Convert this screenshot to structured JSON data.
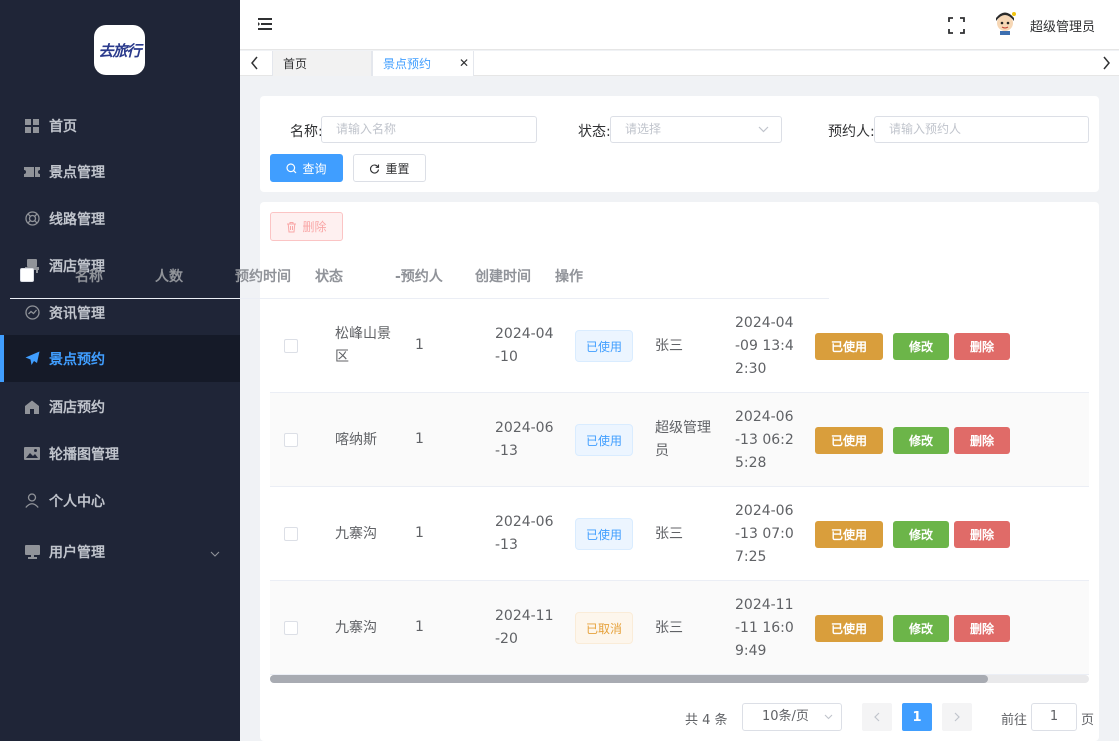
{
  "app": {
    "logo_text": "去旅行"
  },
  "sidebar": {
    "items": [
      {
        "label": "首页",
        "icon": "grid-icon"
      },
      {
        "label": "景点管理",
        "icon": "ticket-icon"
      },
      {
        "label": "线路管理",
        "icon": "lifebuoy-icon"
      },
      {
        "label": "酒店管理",
        "icon": "chair-icon"
      },
      {
        "label": "资讯管理",
        "icon": "chart-circle-icon"
      },
      {
        "label": "景点预约",
        "icon": "paper-plane-icon",
        "active": true
      },
      {
        "label": "酒店预约",
        "icon": "home-icon"
      },
      {
        "label": "轮播图管理",
        "icon": "image-icon"
      },
      {
        "label": "个人中心",
        "icon": "user-icon"
      },
      {
        "label": "用户管理",
        "icon": "monitor-icon",
        "expandable": true
      }
    ]
  },
  "header": {
    "username": "超级管理员"
  },
  "tags": {
    "home": "首页",
    "current": "景点预约"
  },
  "search": {
    "name_label": "名称:",
    "name_placeholder": "请输入名称",
    "status_label": "状态:",
    "status_placeholder": "请选择",
    "booker_label": "预约人:",
    "booker_placeholder": "请输入预约人",
    "query_label": "查询",
    "reset_label": "重置"
  },
  "toolbar": {
    "delete_label": "删除"
  },
  "table": {
    "headers": [
      "名称",
      "人数",
      "预约时间",
      "状态",
      "-预约人",
      "创建时间",
      "操作"
    ],
    "rows": [
      {
        "name": [
          "松峰山景",
          "区"
        ],
        "count": "1",
        "date": [
          "2024-04",
          "-10"
        ],
        "status": "已使用",
        "status_type": "used",
        "booker": [
          "张三"
        ],
        "created": [
          "2024-04",
          "-09 13:4",
          "2:30"
        ]
      },
      {
        "name": [
          "喀纳斯"
        ],
        "count": "1",
        "date": [
          "2024-06",
          "-13"
        ],
        "status": "已使用",
        "status_type": "used",
        "booker": [
          "超级管理",
          "员"
        ],
        "created": [
          "2024-06",
          "-13 06:2",
          "5:28"
        ]
      },
      {
        "name": [
          "九寨沟"
        ],
        "count": "1",
        "date": [
          "2024-06",
          "-13"
        ],
        "status": "已使用",
        "status_type": "used",
        "booker": [
          "张三"
        ],
        "created": [
          "2024-06",
          "-13 07:0",
          "7:25"
        ]
      },
      {
        "name": [
          "九寨沟"
        ],
        "count": "1",
        "date": [
          "2024-11",
          "-20"
        ],
        "status": "已取消",
        "status_type": "cancel",
        "booker": [
          "张三"
        ],
        "created": [
          "2024-11",
          "-11 16:0",
          "9:49"
        ]
      }
    ],
    "actions": {
      "used": "已使用",
      "edit": "修改",
      "delete": "删除"
    }
  },
  "pagination": {
    "total_text": "共 4 条",
    "page_size": "10条/页",
    "current_page": "1",
    "goto_label": "前往",
    "goto_value": "1",
    "page_suffix": "页"
  },
  "colors": {
    "primary": "#409eff",
    "sidebar_bg": "#1f2537",
    "warning": "#d99e3c",
    "success": "#6cb549",
    "danger": "#e06b68"
  }
}
